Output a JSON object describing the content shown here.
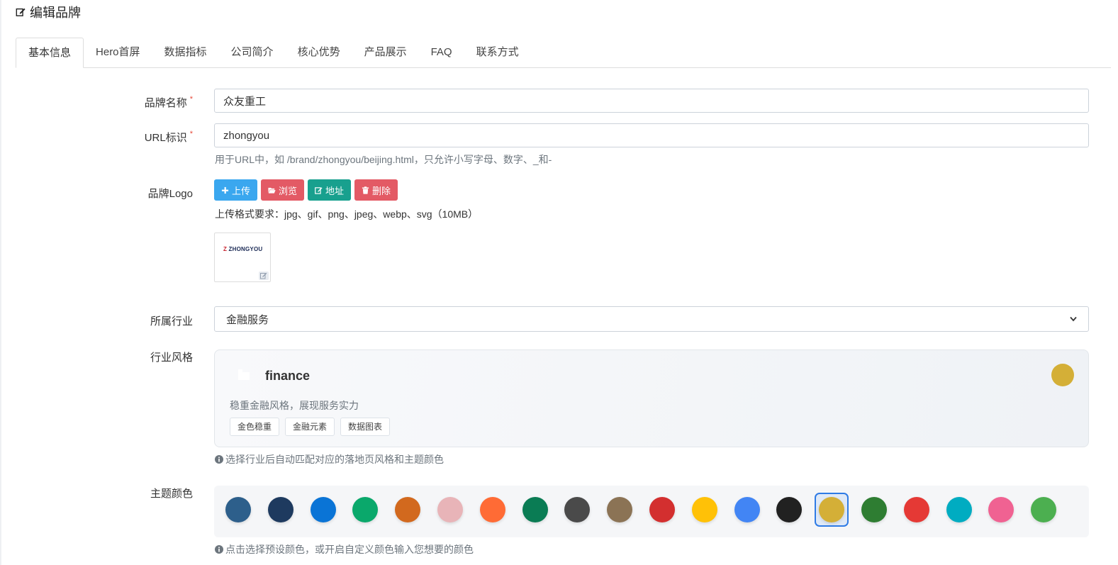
{
  "header": {
    "title": "编辑品牌"
  },
  "tabs": [
    {
      "label": "基本信息",
      "active": true
    },
    {
      "label": "Hero首屏"
    },
    {
      "label": "数据指标"
    },
    {
      "label": "公司简介"
    },
    {
      "label": "核心优势"
    },
    {
      "label": "产品展示"
    },
    {
      "label": "FAQ"
    },
    {
      "label": "联系方式"
    }
  ],
  "form": {
    "brand_name": {
      "label": "品牌名称",
      "required_mark": "*",
      "value": "众友重工"
    },
    "url_slug": {
      "label": "URL标识",
      "required_mark": "*",
      "value": "zhongyou",
      "help": "用于URL中，如 /brand/zhongyou/beijing.html，只允许小写字母、数字、_和-"
    },
    "logo": {
      "label": "品牌Logo",
      "buttons": {
        "upload": "上传",
        "browse": "浏览",
        "url": "地址",
        "delete": "删除"
      },
      "format_hint": "上传格式要求：jpg、gif、png、jpeg、webp、svg（10MB）",
      "preview_text": "ZHONGYOU",
      "preview_mark": "Z"
    },
    "industry": {
      "label": "所属行业",
      "value": "金融服务"
    },
    "industry_style": {
      "label": "行业风格",
      "name": "finance",
      "description": "稳重金融风格，展现服务实力",
      "tags": [
        "金色稳重",
        "金融元素",
        "数据图表"
      ],
      "color": "#d4af37",
      "help": "选择行业后自动匹配对应的落地页风格和主题颜色"
    },
    "theme_color": {
      "label": "主题颜色",
      "selected_index": 14,
      "colors": [
        "#2d5f8b",
        "#1e3a5f",
        "#0a74d6",
        "#0aa86b",
        "#d2691e",
        "#e8b4b8",
        "#ff6b35",
        "#0a7c54",
        "#4a4a4a",
        "#8b7355",
        "#d32f2f",
        "#ffc107",
        "#4285f4",
        "#212121",
        "#d4af37",
        "#2e7d32",
        "#e53935",
        "#00acc1",
        "#f06292",
        "#4caf50"
      ],
      "help": "点击选择预设颜色，或开启自定义颜色输入您想要的颜色"
    }
  }
}
